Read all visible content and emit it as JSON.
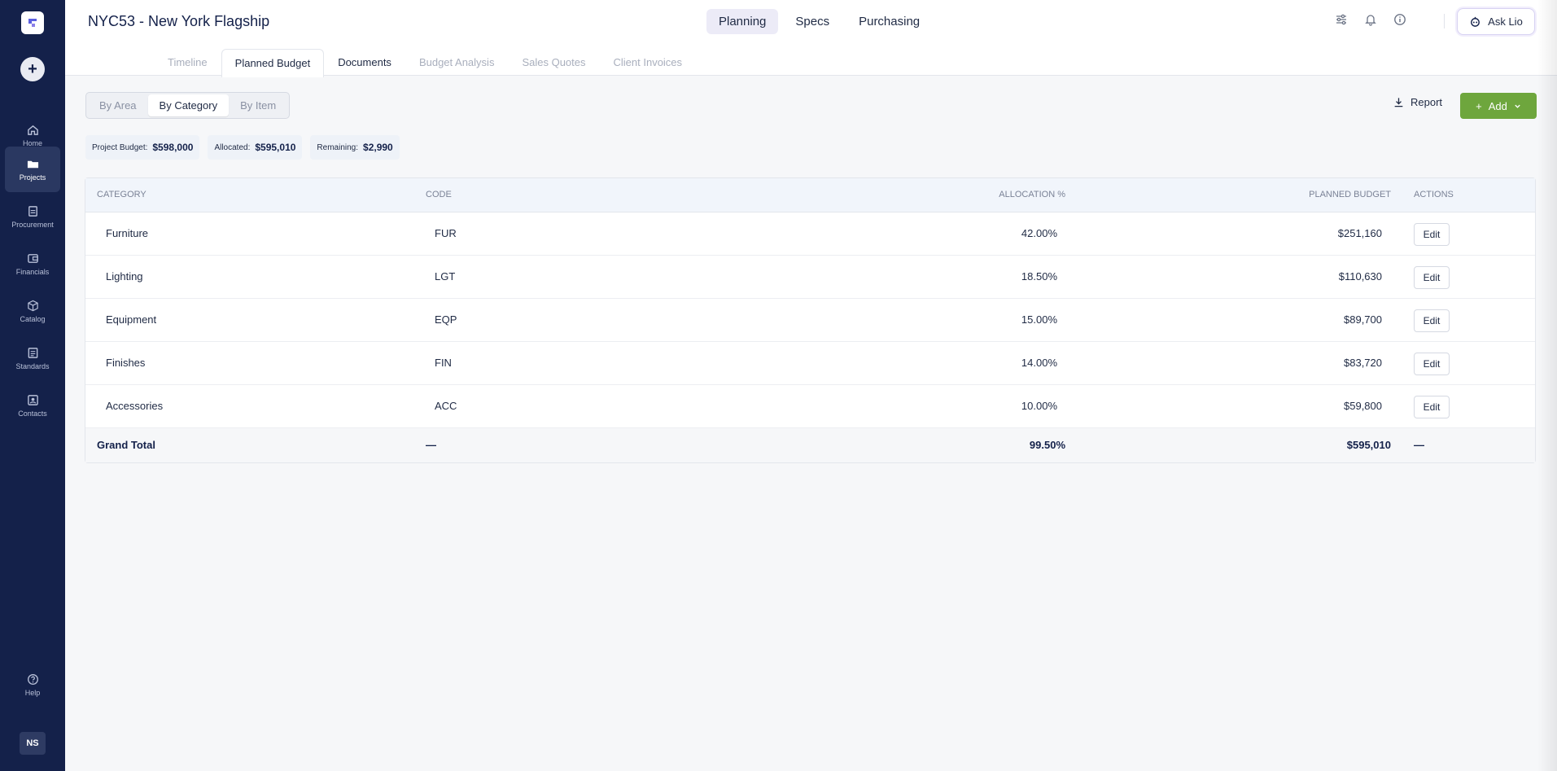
{
  "sidebar": {
    "items": [
      {
        "label": "Home",
        "icon": "home-icon"
      },
      {
        "label": "Projects",
        "icon": "folder-icon"
      },
      {
        "label": "Procurement",
        "icon": "procurement-icon"
      },
      {
        "label": "Financials",
        "icon": "wallet-icon"
      },
      {
        "label": "Catalog",
        "icon": "box-icon"
      },
      {
        "label": "Standards",
        "icon": "document-icon"
      },
      {
        "label": "Contacts",
        "icon": "contact-icon"
      }
    ],
    "help_label": "Help",
    "avatar_initials": "NS"
  },
  "header": {
    "title": "NYC53 - New York Flagship",
    "main_tabs": [
      "Planning",
      "Specs",
      "Purchasing"
    ],
    "ask_label": "Ask Lio"
  },
  "sub_tabs": [
    "Timeline",
    "Planned Budget",
    "Documents",
    "Budget Analysis",
    "Sales Quotes",
    "Client Invoices"
  ],
  "view_toggle": [
    "By Area",
    "By Category",
    "By Item"
  ],
  "actions": {
    "report_label": "Report",
    "add_label": "Add"
  },
  "stats": [
    {
      "label": "Project Budget:",
      "value": "$598,000"
    },
    {
      "label": "Allocated:",
      "value": "$595,010"
    },
    {
      "label": "Remaining:",
      "value": "$2,990"
    }
  ],
  "table": {
    "columns": [
      "CATEGORY",
      "CODE",
      "ALLOCATION %",
      "PLANNED BUDGET",
      "ACTIONS"
    ],
    "rows": [
      {
        "category": "Furniture",
        "code": "FUR",
        "allocation": "42.00%",
        "budget": "$251,160",
        "action": "Edit"
      },
      {
        "category": "Lighting",
        "code": "LGT",
        "allocation": "18.50%",
        "budget": "$110,630",
        "action": "Edit"
      },
      {
        "category": "Equipment",
        "code": "EQP",
        "allocation": "15.00%",
        "budget": "$89,700",
        "action": "Edit"
      },
      {
        "category": "Finishes",
        "code": "FIN",
        "allocation": "14.00%",
        "budget": "$83,720",
        "action": "Edit"
      },
      {
        "category": "Accessories",
        "code": "ACC",
        "allocation": "10.00%",
        "budget": "$59,800",
        "action": "Edit"
      }
    ],
    "total": {
      "label": "Grand Total",
      "code": "—",
      "allocation": "99.50%",
      "budget": "$595,010",
      "action": "—"
    }
  },
  "colors": {
    "sidebar": "#14214a",
    "accent_green": "#6ea63d",
    "active_tab": "#ecebf7"
  }
}
